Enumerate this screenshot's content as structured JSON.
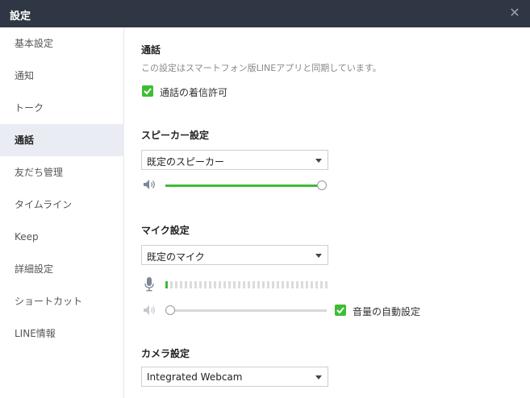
{
  "window": {
    "title": "設定",
    "close_icon": "close-icon"
  },
  "sidebar": {
    "items": [
      {
        "label": "基本設定"
      },
      {
        "label": "通知"
      },
      {
        "label": "トーク"
      },
      {
        "label": "通話",
        "active": true
      },
      {
        "label": "友だち管理"
      },
      {
        "label": "タイムライン"
      },
      {
        "label": "Keep"
      },
      {
        "label": "詳細設定"
      },
      {
        "label": "ショートカット"
      },
      {
        "label": "LINE情報"
      }
    ]
  },
  "call": {
    "title": "通話",
    "subtitle": "この設定はスマートフォン版LINEアプリと同期しています。",
    "allow_incoming": {
      "label": "通話の着信許可",
      "checked": true
    }
  },
  "speaker": {
    "title": "スピーカー設定",
    "device": "既定のスピーカー",
    "volume": 1.0,
    "icon": "speaker-icon"
  },
  "mic": {
    "title": "マイク設定",
    "device": "既定のマイク",
    "icon": "microphone-icon",
    "level_segments_total": 34,
    "level_segments_active": 1,
    "volume": 0.0,
    "auto_volume": {
      "label": "音量の自動設定",
      "checked": true
    }
  },
  "camera": {
    "title": "カメラ設定",
    "device": "Integrated Webcam"
  },
  "colors": {
    "titlebar": "#2f3744",
    "accent": "#3dbd34",
    "sidebar_active": "#e9ecf2"
  }
}
